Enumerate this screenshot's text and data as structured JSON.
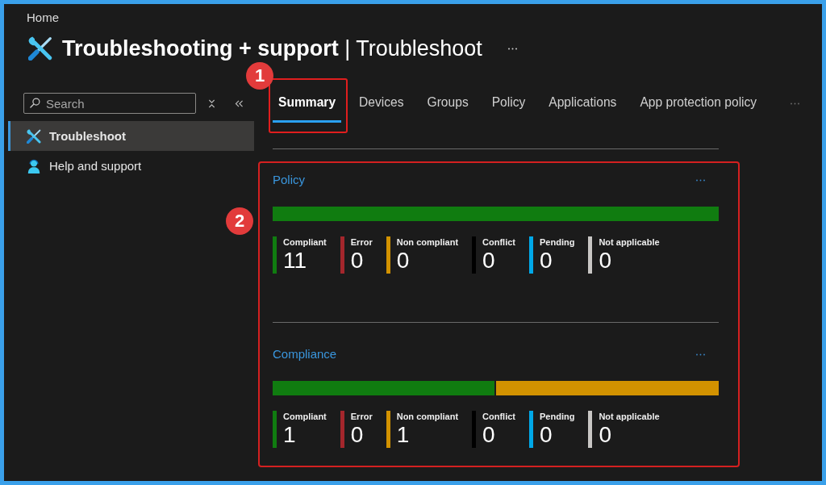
{
  "breadcrumb": "Home",
  "title": "**Troubleshooting + support** | Troubleshoot",
  "sidebar": {
    "search": {
      "placeholder": "Search"
    },
    "items": [
      {
        "label": "Troubleshoot",
        "selected": true
      },
      {
        "label": "Help and support",
        "selected": false
      }
    ]
  },
  "tabs": [
    {
      "label": "Summary",
      "selected": true,
      "callout": "1"
    },
    {
      "label": "Devices",
      "selected": false
    },
    {
      "label": "Groups",
      "selected": false
    },
    {
      "label": "Policy",
      "selected": false
    },
    {
      "label": "Applications",
      "selected": false
    },
    {
      "label": "App protection policy",
      "selected": false
    }
  ],
  "panels": {
    "callout": "2",
    "items": [
      {
        "title": "Policy",
        "bar": {
          "level": 1
        },
        "legend": [
          {
            "label": "Compliant",
            "count": "11",
            "color": "#107c10"
          },
          {
            "label": "Error",
            "count": "0",
            "color": "#a4262c"
          },
          {
            "label": "Non compliant",
            "count": "0",
            "color": "#d29200"
          },
          {
            "label": "Conflict",
            "count": "0",
            "color": "#000000"
          },
          {
            "label": "Pending",
            "count": "0",
            "color": "#00a8e8"
          },
          {
            "label": "Not applicable",
            "count": "0",
            "color": "#c8c6c4"
          }
        ]
      },
      {
        "title": "Compliance",
        "bar": {
          "level": 0.5
        },
        "legend": [
          {
            "label": "Compliant",
            "count": "1",
            "color": "#107c10"
          },
          {
            "label": "Error",
            "count": "0",
            "color": "#a4262c"
          },
          {
            "label": "Non compliant",
            "count": "1",
            "color": "#d29200"
          },
          {
            "label": "Conflict",
            "count": "0",
            "color": "#000000"
          },
          {
            "label": "Pending",
            "count": "0",
            "color": "#00a8e8"
          },
          {
            "label": "Not applicable",
            "count": "0",
            "color": "#c8c6c4"
          }
        ]
      }
    ]
  }
}
